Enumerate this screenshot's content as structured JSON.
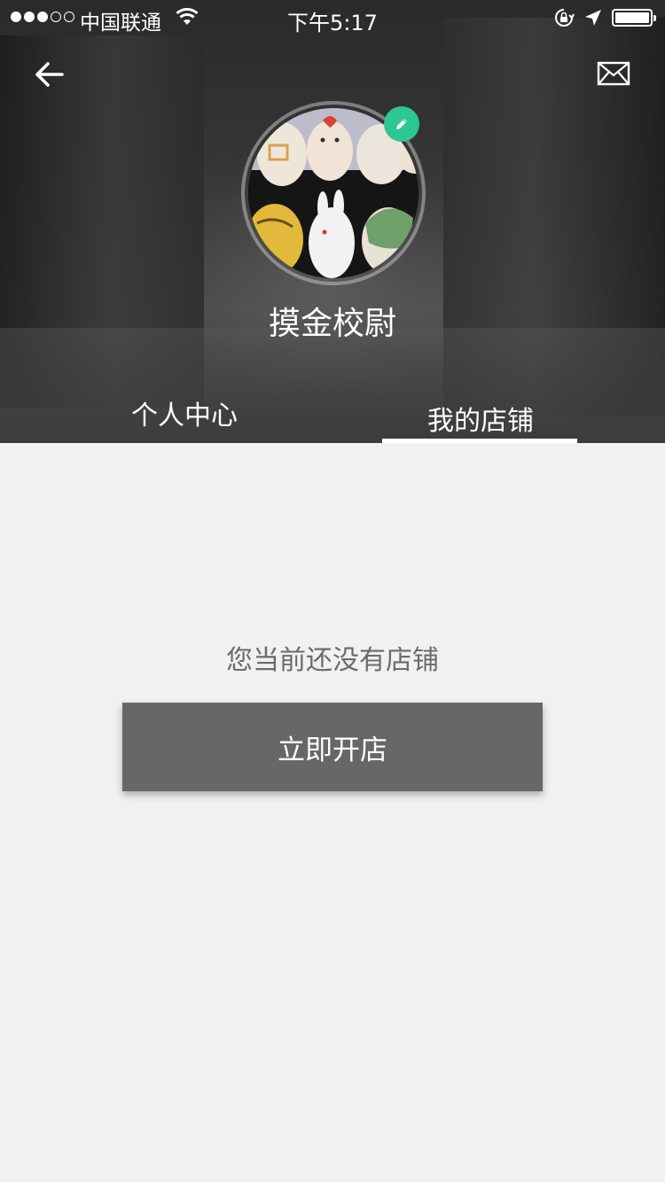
{
  "status_bar": {
    "carrier": "中国联通",
    "time": "下午5:17"
  },
  "header": {
    "username": "摸金校尉"
  },
  "tabs": [
    {
      "label": "个人中心",
      "active": false
    },
    {
      "label": "我的店铺",
      "active": true
    }
  ],
  "empty_state": {
    "message": "您当前还没有店铺",
    "button_label": "立即开店"
  },
  "icons": {
    "back": "arrow-left-icon",
    "mail": "envelope-icon",
    "edit": "pencil-icon",
    "wifi": "wifi-icon",
    "lock": "orientation-lock-icon",
    "location": "location-arrow-icon",
    "battery": "battery-icon"
  },
  "colors": {
    "edit_badge": "#2cc792",
    "button_bg": "#676767",
    "page_bg": "#f1f1f1"
  }
}
